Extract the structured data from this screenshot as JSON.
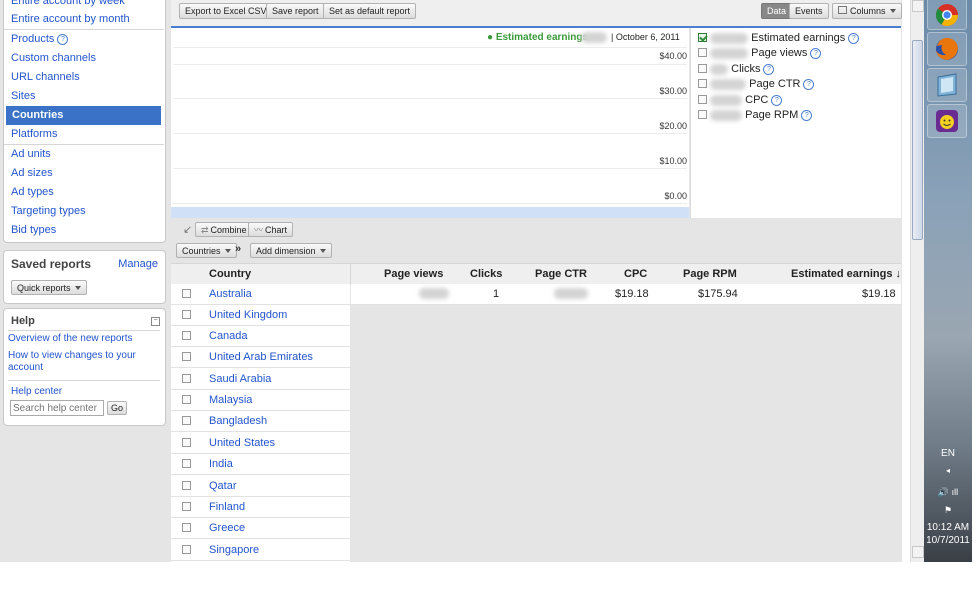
{
  "sidebar": {
    "nav_items": [
      {
        "label": "Entire account by week"
      },
      {
        "label": "Entire account by month"
      },
      {
        "label": "Products"
      },
      {
        "label": "Custom channels"
      },
      {
        "label": "URL channels"
      },
      {
        "label": "Sites"
      },
      {
        "label": "Countries",
        "selected": true
      },
      {
        "label": "Platforms"
      },
      {
        "label": "Ad units"
      },
      {
        "label": "Ad sizes"
      },
      {
        "label": "Ad types"
      },
      {
        "label": "Targeting types"
      },
      {
        "label": "Bid types"
      }
    ],
    "saved_reports": {
      "title": "Saved reports",
      "manage": "Manage",
      "quick_reports": "Quick reports"
    },
    "help": {
      "title": "Help",
      "links": [
        "Overview of the new reports",
        "How to view changes to your account"
      ],
      "help_center": "Help center",
      "search_placeholder": "Search help center",
      "go": "Go"
    }
  },
  "toolbar": {
    "export_csv": "Export to Excel CSV",
    "save_report": "Save report",
    "set_default": "Set as default report",
    "data": "Data",
    "events": "Events",
    "columns": "Columns"
  },
  "chart": {
    "legend": "Estimated earnings",
    "date": "October 6, 2011",
    "yticks": [
      "$40.00",
      "$30.00",
      "$20.00",
      "$10.00",
      "$0.00"
    ]
  },
  "metrics": [
    {
      "label": "Estimated earnings",
      "checked": true
    },
    {
      "label": "Page views",
      "checked": false
    },
    {
      "label": "Clicks",
      "checked": false
    },
    {
      "label": "Page CTR",
      "checked": false
    },
    {
      "label": "CPC",
      "checked": false
    },
    {
      "label": "Page RPM",
      "checked": false
    }
  ],
  "controls": {
    "combine": "Combine",
    "chart": "Chart",
    "countries": "Countries",
    "separator": "»",
    "add_dimension": "Add dimension"
  },
  "table": {
    "headers": {
      "country": "Country",
      "page_views": "Page views",
      "clicks": "Clicks",
      "page_ctr": "Page CTR",
      "cpc": "CPC",
      "page_rpm": "Page RPM",
      "earnings": "Estimated earnings ↓"
    },
    "countries": [
      "Australia",
      "United Kingdom",
      "Canada",
      "United Arab Emirates",
      "Saudi Arabia",
      "Malaysia",
      "Bangladesh",
      "United States",
      "India",
      "Qatar",
      "Finland",
      "Greece",
      "Singapore"
    ],
    "first_row": {
      "clicks": "1",
      "cpc": "$19.18",
      "page_rpm": "$175.94",
      "earnings": "$19.18"
    }
  },
  "taskbar": {
    "lang": "EN",
    "time": "10:12 AM",
    "date": "10/7/2011",
    "icons": [
      "chrome-icon",
      "firefox-icon",
      "window-app-icon",
      "yahoo-messenger-icon"
    ]
  },
  "colors": {
    "link": "#2255cc",
    "selected": "#3a72c7",
    "accent_line": "#4a7fd0",
    "earnings_green": "#3a9a3a"
  }
}
